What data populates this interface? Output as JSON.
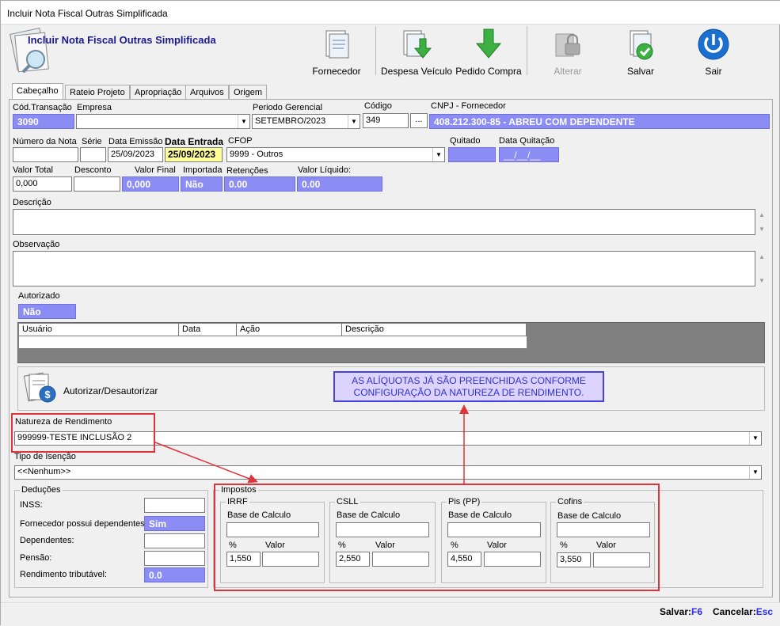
{
  "window": {
    "title": "Incluir Nota Fiscal Outras Simplificada"
  },
  "header": {
    "title": "Incluir Nota Fiscal Outras Simplificada"
  },
  "toolbar": {
    "fornecedor": "Fornecedor",
    "despesa_veiculo": "Despesa Veículo",
    "pedido_compra": "Pedido Compra",
    "alterar": "Alterar",
    "salvar": "Salvar",
    "sair": "Sair"
  },
  "tabs": [
    "Cabeçalho",
    "Rateio Projeto",
    "Apropriação",
    "Arquivos",
    "Origem"
  ],
  "form": {
    "cod_transacao_label": "Cód.Transação",
    "cod_transacao": "3090",
    "empresa_label": "Empresa",
    "empresa": "",
    "periodo_label": "Periodo Gerencial",
    "periodo": "SETEMBRO/2023",
    "codigo_label": "Código",
    "codigo": "349",
    "ellipsis": "...",
    "cnpj_label": "CNPJ - Fornecedor",
    "cnpj": "408.212.300-85 - ABREU COM DEPENDENTE",
    "numero_nota_label": "Número da Nota",
    "numero_nota": "",
    "serie_label": "Série",
    "serie": "",
    "data_emissao_label": "Data Emissão",
    "data_emissao": "25/09/2023",
    "data_entrada_label": "Data Entrada",
    "data_entrada": "25/09/2023",
    "cfop_label": "CFOP",
    "cfop": "9999 - Outros",
    "quitado_label": "Quitado",
    "quitado": "",
    "data_quitacao_label": "Data Quitação",
    "data_quitacao": "__/__/__",
    "valor_total_label": "Valor Total",
    "valor_total": "0,000",
    "desconto_label": "Desconto",
    "desconto": "",
    "valor_final_label": "Valor Final",
    "valor_final": "0,000",
    "importada_label": "Importada",
    "importada": "Não",
    "retencoes_label": "Retenções",
    "retencoes": "0.00",
    "valor_liquido_label": "Valor Líquido:",
    "valor_liquido": "0.00",
    "descricao_label": "Descrição",
    "observacao_label": "Observação",
    "autorizado_label": "Autorizado",
    "autorizado": "Não"
  },
  "grid": {
    "columns": [
      "Usuário",
      "Data",
      "Ação",
      "Descrição"
    ]
  },
  "autorizar": {
    "label": "Autorizar/Desautorizar"
  },
  "note": {
    "line1": "AS ALÍQUOTAS JÁ SÃO PREENCHIDAS CONFORME",
    "line2": "CONFIGURAÇÃO DA NATUREZA DE RENDIMENTO."
  },
  "natureza": {
    "label": "Natureza de Rendimento",
    "value": "999999-TESTE INCLUSÃO 2"
  },
  "isencao": {
    "label": "Tipo de Isenção",
    "value": "<<Nenhum>>"
  },
  "deducoes": {
    "title": "Deduções",
    "inss_label": "INSS:",
    "dependentes_flag_label": "Fornecedor possui dependentes:",
    "dependentes_flag": "Sim",
    "dependentes_label": "Dependentes:",
    "pensao_label": "Pensão:",
    "rendimento_label": "Rendimento tributável:",
    "rendimento": "0.0"
  },
  "impostos": {
    "title": "Impostos",
    "base_label": "Base de Calculo",
    "pct_label": "%",
    "valor_label": "Valor",
    "items": [
      {
        "name": "IRRF",
        "pct": "1,550"
      },
      {
        "name": "CSLL",
        "pct": "2,550"
      },
      {
        "name": "Pis (PP)",
        "pct": "4,550"
      },
      {
        "name": "Cofins",
        "pct": "3,550"
      }
    ]
  },
  "status": {
    "salvar_label": "Salvar:",
    "salvar_key": "F6",
    "cancelar_label": "Cancelar:",
    "cancelar_key": "Esc"
  }
}
